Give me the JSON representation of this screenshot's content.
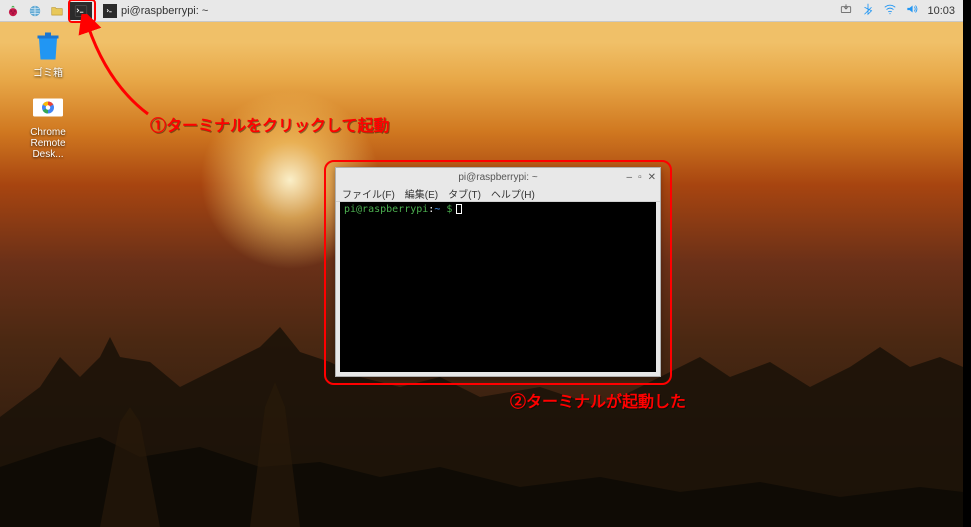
{
  "taskbar": {
    "task_label": "pi@raspberrypi: ~",
    "clock": "10:03"
  },
  "desktop_icons": {
    "trash": "ゴミ箱",
    "chrome_remote": "Chrome Remote Desk..."
  },
  "terminal": {
    "title": "pi@raspberrypi: ~",
    "menu": {
      "file": "ファイル(F)",
      "edit": "編集(E)",
      "tab": "タブ(T)",
      "help": "ヘルプ(H)"
    },
    "prompt_user": "pi@raspberrypi",
    "prompt_sep": ":",
    "prompt_path": "~",
    "prompt_dollar": " $"
  },
  "annotations": {
    "a1": "①ターミナルをクリックして起動",
    "a2": "②ターミナルが起動した"
  }
}
